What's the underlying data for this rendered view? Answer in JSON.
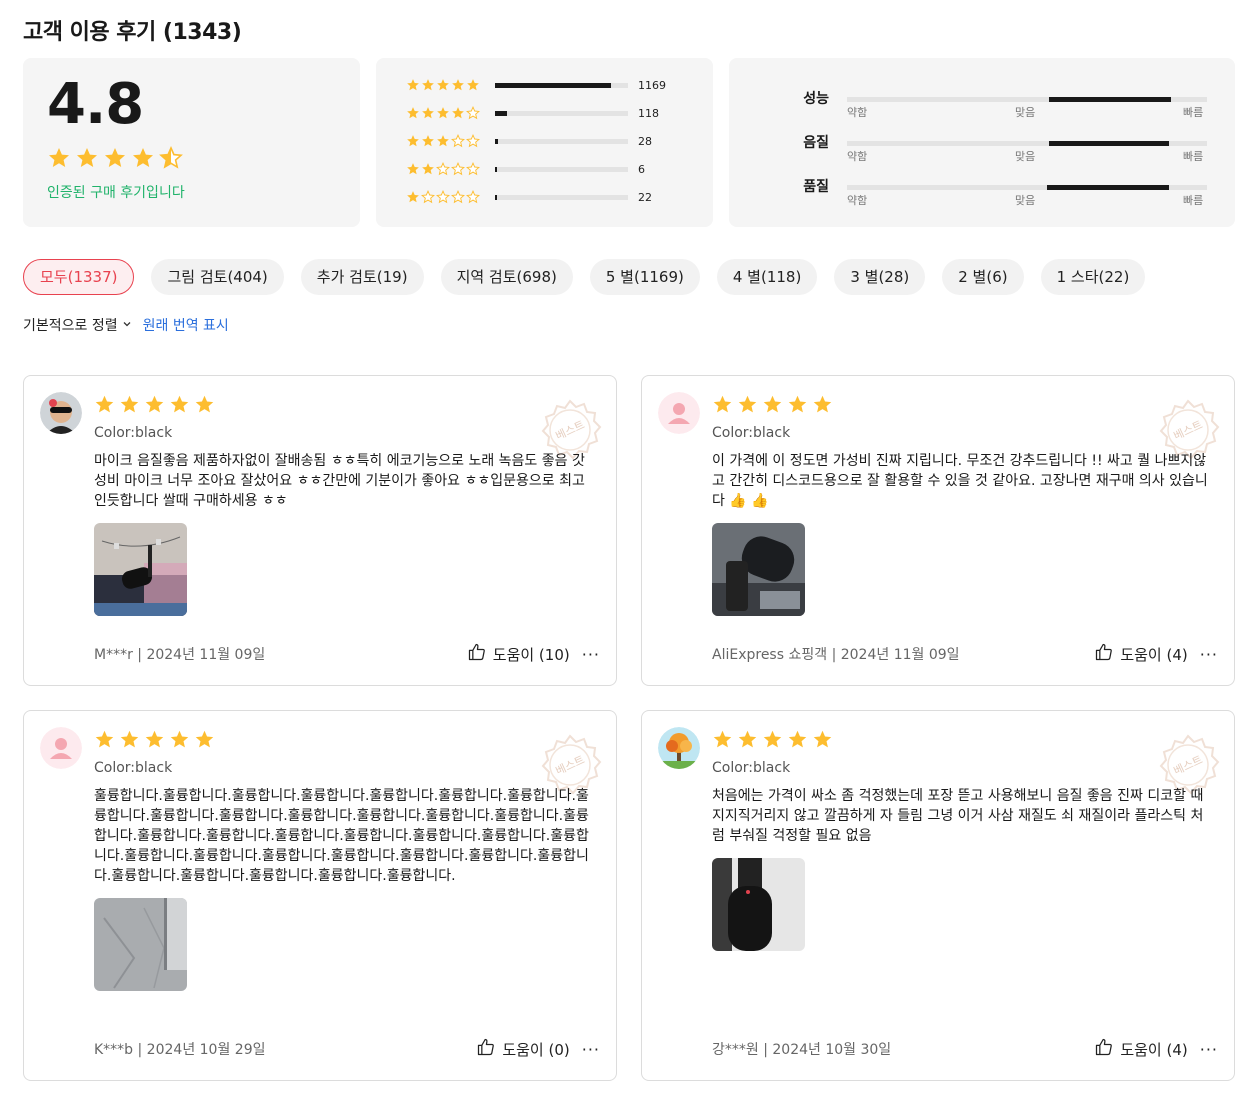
{
  "header": {
    "title": "고객 이용 후기 (1343)"
  },
  "summary": {
    "rating": "4.8",
    "rating_value": 4.5,
    "verified": "인증된 구매 후기입니다"
  },
  "distribution": [
    {
      "stars": 5,
      "count": "1169",
      "value": 1169
    },
    {
      "stars": 4,
      "count": "118",
      "value": 118
    },
    {
      "stars": 3,
      "count": "28",
      "value": 28
    },
    {
      "stars": 2,
      "count": "6",
      "value": 6
    },
    {
      "stars": 1,
      "count": "22",
      "value": 22
    }
  ],
  "attributes": [
    {
      "label": "성능",
      "low": "약함",
      "mid": "맞음",
      "high": "빠름",
      "from": 0.56,
      "to": 0.9
    },
    {
      "label": "음질",
      "low": "약함",
      "mid": "맞음",
      "high": "빠름",
      "from": 0.56,
      "to": 0.895
    },
    {
      "label": "품질",
      "low": "약함",
      "mid": "맞음",
      "high": "빠름",
      "from": 0.555,
      "to": 0.895
    }
  ],
  "filters": [
    "모두(1337)",
    "그림 검토(404)",
    "추가 검토(19)",
    "지역 검토(698)",
    "5 별(1169)",
    "4 별(118)",
    "3 별(28)",
    "2 별(6)",
    "1 스타(22)"
  ],
  "sort": {
    "label": "기본적으로 정렬",
    "translate": "원래 번역 표시"
  },
  "badge_text": "베스트",
  "reviews": [
    {
      "stars": 5,
      "avatar": "user-photo",
      "variant": "Color:black",
      "text": "마이크 음질좋음 제품하자없이 잘배송됨 ㅎㅎ특히 에코기능으로 노래 녹음도 좋음 갓성비 마이크 너무 조아요 잘샀어요 ㅎㅎ간만에 기분이가 좋아요 ㅎㅎ입문용으로 최고인듯합니다 쌀때 구매하세용 ㅎㅎ",
      "photo": "desk-mic",
      "meta": "M***r | 2024년 11월 09일",
      "helpful": "도움이 (10)"
    },
    {
      "stars": 5,
      "avatar": "default-avatar",
      "variant": "Color:black",
      "text": "이 가격에 이 정도면 가성비 진짜 지립니다. 무조건 강추드립니다 !! 싸고 퀄 나쁘지않고 간간히 디스코드용으로 잘 활용할 수 있을 것 같아요. 고장나면 재구매 의사 있습니다 👍 👍",
      "photo": "mic-closeup",
      "meta": "AliExpress 쇼핑객 | 2024년 11월 09일",
      "helpful": "도움이 (4)"
    },
    {
      "stars": 5,
      "avatar": "default-avatar",
      "variant": "Color:black",
      "text": "훌륭합니다.훌륭합니다.훌륭합니다.훌륭합니다.훌륭합니다.훌륭합니다.훌륭합니다.훌륭합니다.훌륭합니다.훌륭합니다.훌륭합니다.훌륭합니다.훌륭합니다.훌륭합니다.훌륭합니다.훌륭합니다.훌륭합니다.훌륭합니다.훌륭합니다.훌륭합니다.훌륭합니다.훌륭합니다.훌륭합니다.훌륭합니다.훌륭합니다.훌륭합니다.훌륭합니다.훌륭합니다.훌륭합니다.훌륭합니다.훌륭합니다.훌륭합니다.훌륭합니다.훌륭합니다.",
      "photo": "floor-box",
      "meta": "K***b | 2024년 10월 29일",
      "helpful": "도움이 (0)"
    },
    {
      "stars": 5,
      "avatar": "tree-avatar",
      "variant": "Color:black",
      "text": "처음에는 가격이 싸소 좀 걱정했는데 포장 뜯고 사용해보니 음질 좋음 진짜 디코할 때 지지직거리지 않고 깔끔하게 자 들림 그녕 이거 사삼 재질도 쇠 재질이라 플라스틱 처럼 부숴질 걱정할 필요 없음",
      "photo": "mic-dark",
      "meta": "강***원 | 2024년 10월 30일",
      "helpful": "도움이 (4)"
    }
  ],
  "colors": {
    "star": "#fdbd2f",
    "accent": "#e8424f",
    "verified": "#21b36b",
    "link": "#2b6fdc"
  }
}
